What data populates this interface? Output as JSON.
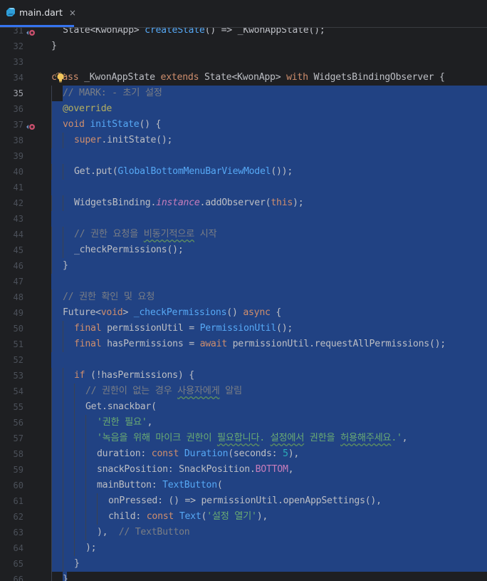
{
  "tab": {
    "filename": "main.dart",
    "close_glyph": "×",
    "icon": "dart-file-icon"
  },
  "colors": {
    "keyword": "#cf8e6d",
    "function": "#56a8f5",
    "comment": "#7a7e85",
    "string": "#6aab73",
    "annotation": "#b3ae60",
    "number": "#2aacb8",
    "selection": "#214283",
    "background": "#1e1f22"
  },
  "lines": [
    {
      "n": "31",
      "tokens": [
        [
          "t",
          "State<KwonApp> "
        ],
        [
          "f",
          "createState"
        ],
        [
          "t",
          "() => "
        ],
        [
          "t",
          "_KwonAppState"
        ],
        [
          "t",
          "();"
        ]
      ],
      "indent": 1
    },
    {
      "n": "32",
      "tokens": [
        [
          "t",
          "}"
        ]
      ]
    },
    {
      "n": "33",
      "tokens": []
    },
    {
      "n": "34",
      "tokens": [
        [
          "k",
          "class"
        ],
        [
          "t",
          " _KwonAppState "
        ],
        [
          "k",
          "extends"
        ],
        [
          "t",
          " State<KwonApp> "
        ],
        [
          "k",
          "with"
        ],
        [
          "t",
          " WidgetsBindingObserver {"
        ]
      ]
    },
    {
      "n": "35",
      "tokens": [
        [
          "c",
          "// MARK: - 초기 설정"
        ]
      ],
      "indent": 1
    },
    {
      "n": "36",
      "tokens": [
        [
          "a",
          "@override"
        ]
      ],
      "indent": 1
    },
    {
      "n": "37",
      "tokens": [
        [
          "k",
          "void"
        ],
        [
          "t",
          " "
        ],
        [
          "f",
          "initState"
        ],
        [
          "t",
          "() {"
        ]
      ],
      "indent": 1
    },
    {
      "n": "38",
      "tokens": [
        [
          "k",
          "super"
        ],
        [
          "t",
          ".initState();"
        ]
      ],
      "indent": 2
    },
    {
      "n": "39",
      "tokens": []
    },
    {
      "n": "40",
      "tokens": [
        [
          "t",
          "Get.put("
        ],
        [
          "f",
          "GlobalBottomMenuBarViewModel"
        ],
        [
          "t",
          "());"
        ]
      ],
      "indent": 2
    },
    {
      "n": "41",
      "tokens": []
    },
    {
      "n": "42",
      "tokens": [
        [
          "t",
          "WidgetsBinding."
        ],
        [
          "i",
          "instance"
        ],
        [
          "t",
          ".addObserver("
        ],
        [
          "k",
          "this"
        ],
        [
          "t",
          ");"
        ]
      ],
      "indent": 2
    },
    {
      "n": "43",
      "tokens": []
    },
    {
      "n": "44",
      "tokens": [
        [
          "c",
          "// 권한 요청을 "
        ],
        [
          "cu",
          "비동기적으로"
        ],
        [
          "c",
          " 시작"
        ]
      ],
      "indent": 2
    },
    {
      "n": "45",
      "tokens": [
        [
          "t",
          "_checkPermissions();"
        ]
      ],
      "indent": 2
    },
    {
      "n": "46",
      "tokens": [
        [
          "t",
          "}"
        ]
      ],
      "indent": 1
    },
    {
      "n": "47",
      "tokens": []
    },
    {
      "n": "48",
      "tokens": [
        [
          "c",
          "// 권한 확인 및 요청"
        ]
      ],
      "indent": 1
    },
    {
      "n": "49",
      "tokens": [
        [
          "t",
          "Future<"
        ],
        [
          "k",
          "void"
        ],
        [
          "t",
          "> "
        ],
        [
          "f",
          "_checkPermissions"
        ],
        [
          "t",
          "() "
        ],
        [
          "k",
          "async"
        ],
        [
          "t",
          " {"
        ]
      ],
      "indent": 1
    },
    {
      "n": "50",
      "tokens": [
        [
          "k",
          "final"
        ],
        [
          "t",
          " permissionUtil = "
        ],
        [
          "f",
          "PermissionUtil"
        ],
        [
          "t",
          "();"
        ]
      ],
      "indent": 2
    },
    {
      "n": "51",
      "tokens": [
        [
          "k",
          "final"
        ],
        [
          "t",
          " hasPermissions = "
        ],
        [
          "k",
          "await"
        ],
        [
          "t",
          " permissionUtil.requestAllPermissions();"
        ]
      ],
      "indent": 2
    },
    {
      "n": "52",
      "tokens": []
    },
    {
      "n": "53",
      "tokens": [
        [
          "k",
          "if"
        ],
        [
          "t",
          " (!hasPermissions) {"
        ]
      ],
      "indent": 2
    },
    {
      "n": "54",
      "tokens": [
        [
          "c",
          "// 권한이 없는 경우 "
        ],
        [
          "cu",
          "사용자에게"
        ],
        [
          "c",
          " 알림"
        ]
      ],
      "indent": 3
    },
    {
      "n": "55",
      "tokens": [
        [
          "t",
          "Get.snackbar("
        ]
      ],
      "indent": 3
    },
    {
      "n": "56",
      "tokens": [
        [
          "s",
          "'권한 필요'"
        ],
        [
          "t",
          ","
        ]
      ],
      "indent": 4
    },
    {
      "n": "57",
      "tokens": [
        [
          "s",
          "'녹음을 위해 마이크 권한이 "
        ],
        [
          "su",
          "필요합니다"
        ],
        [
          "s",
          ". "
        ],
        [
          "su",
          "설정에서"
        ],
        [
          "s",
          " 권한을 "
        ],
        [
          "su",
          "허용해주세요"
        ],
        [
          "s",
          ".'"
        ],
        [
          "t",
          ","
        ]
      ],
      "indent": 4
    },
    {
      "n": "58",
      "tokens": [
        [
          "t",
          "duration: "
        ],
        [
          "k",
          "const"
        ],
        [
          "t",
          " "
        ],
        [
          "f",
          "Duration"
        ],
        [
          "t",
          "(seconds: "
        ],
        [
          "n",
          "5"
        ],
        [
          "t",
          "),"
        ]
      ],
      "indent": 4
    },
    {
      "n": "59",
      "tokens": [
        [
          "t",
          "snackPosition: SnackPosition."
        ],
        [
          "p",
          "BOTTOM"
        ],
        [
          "t",
          ","
        ]
      ],
      "indent": 4
    },
    {
      "n": "60",
      "tokens": [
        [
          "t",
          "mainButton: "
        ],
        [
          "f",
          "TextButton"
        ],
        [
          "t",
          "("
        ]
      ],
      "indent": 4
    },
    {
      "n": "61",
      "tokens": [
        [
          "t",
          "onPressed: () => permissionUtil.openAppSettings(),"
        ]
      ],
      "indent": 5
    },
    {
      "n": "62",
      "tokens": [
        [
          "t",
          "child: "
        ],
        [
          "k",
          "const"
        ],
        [
          "t",
          " "
        ],
        [
          "f",
          "Text"
        ],
        [
          "t",
          "("
        ],
        [
          "s",
          "'설정 열기'"
        ],
        [
          "t",
          "),"
        ]
      ],
      "indent": 5
    },
    {
      "n": "63",
      "tokens": [
        [
          "t",
          "),  "
        ],
        [
          "c",
          "// TextButton"
        ]
      ],
      "indent": 4
    },
    {
      "n": "64",
      "tokens": [
        [
          "t",
          ");"
        ]
      ],
      "indent": 3
    },
    {
      "n": "65",
      "tokens": [
        [
          "t",
          "}"
        ]
      ],
      "indent": 2
    },
    {
      "n": "66",
      "tokens": [
        [
          "t",
          "}"
        ]
      ],
      "indent": 1
    }
  ]
}
